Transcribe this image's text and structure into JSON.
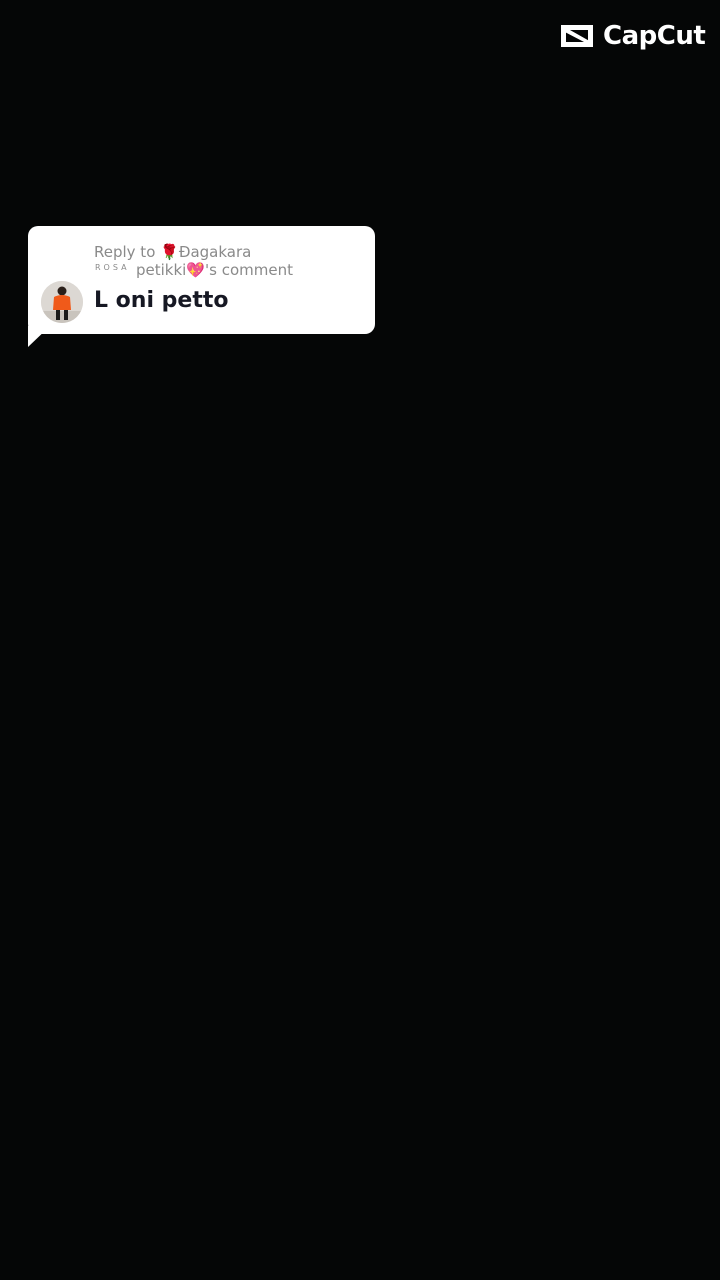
{
  "watermark": {
    "brand": "CapCut",
    "icon": "capcut-logo-icon"
  },
  "reply_bubble": {
    "reply_prefix": "Reply to ",
    "reply_name_line1": "Đagakara",
    "reply_name_line2": "petikki",
    "reply_suffix": "'s comment",
    "rose_emoji": "🌹",
    "heart_emoji": "💖",
    "rosa_tag": "ROSA",
    "comment": "L oni petto",
    "avatar_icon": "user-avatar"
  },
  "colors": {
    "background": "#050606",
    "bubble": "#ffffff",
    "reply_text": "#8a8a8a",
    "comment_text": "#161823",
    "avatar_shirt": "#f05a1a"
  }
}
